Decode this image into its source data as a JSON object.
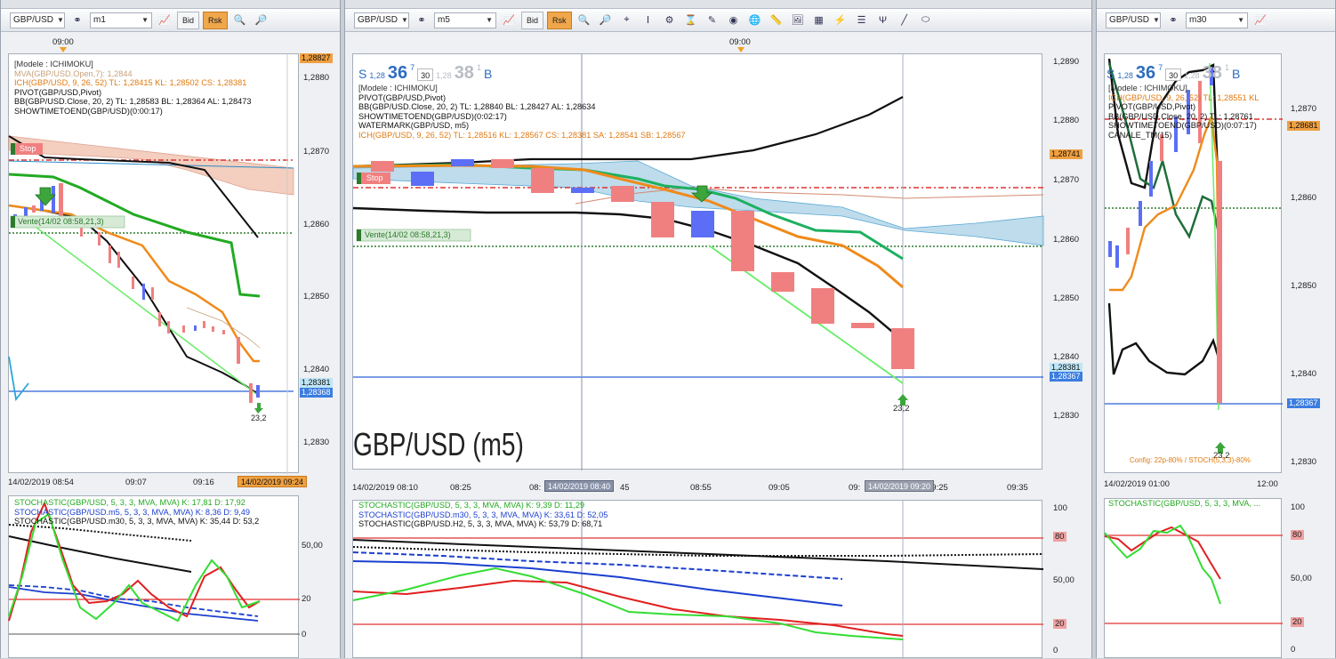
{
  "panels": {
    "left": {
      "toolbar": {
        "symbol": "GBP/USD",
        "timeframe": "m1",
        "bid_label": "Bid",
        "ask_label": "Rsk"
      },
      "top_time": "09:00",
      "legend": [
        {
          "text": "[Modele : ICHIMOKU]",
          "color": "#333333"
        },
        {
          "text": "MVA(GBP/USD.Open,7): 1,2844",
          "color": "#c8a27a"
        },
        {
          "text": "ICH(GBP/USD, 9, 26, 52)  TL: 1,28415  KL: 1,28502  CS: 1,28381",
          "color": "#e07a10"
        },
        {
          "text": "PIVOT(GBP/USD,Pivot)",
          "color": "#111111"
        },
        {
          "text": "BB(GBP/USD.Close, 20, 2)  TL: 1,28583  BL: 1,28364  AL: 1,28473",
          "color": "#111111"
        },
        {
          "text": "SHOWTIMETOEND(GBP/USD)(0:00:17)",
          "color": "#111111"
        }
      ],
      "price_ticks": [
        "1,2880",
        "1,2870",
        "1,2860",
        "1,2850",
        "1,2840",
        "1,2830"
      ],
      "price_tags": {
        "top": "1,28827",
        "cs": "1,28381",
        "last": "1,28368"
      },
      "stop_label": "Stop",
      "vente_label": "Vente(14/02 08:58,21,3)",
      "signal_value": "23,2",
      "time_ticks": [
        "14/02/2019 08:54",
        "09:07",
        "09:16"
      ],
      "time_tag": "14/02/2019 09:24",
      "osc_legend": [
        {
          "text": "STOCHASTIC(GBP/USD, 5, 3, 3, MVA, MVA)  K: 17,81  D: 17,92",
          "color": "#22aa22"
        },
        {
          "text": "STOCHASTIC(GBP/USD.m5, 5, 3, 3, MVA, MVA)  K: 8,36  D: 9,49",
          "color": "#1a3fcf"
        },
        {
          "text": "STOCHASTIC(GBP/USD.m30, 5, 3, 3, MVA, MVA)  K: 35,44  D: 53,2",
          "color": "#111111"
        }
      ],
      "osc_ticks": [
        "50,00",
        "20",
        "0"
      ]
    },
    "middle": {
      "toolbar": {
        "symbol": "GBP/USD",
        "timeframe": "m5",
        "bid_label": "Bid",
        "ask_label": "Rsk"
      },
      "top_time": "09:00",
      "sblock": {
        "s": "S",
        "s_small": "1,28",
        "s_big": "36",
        "s_sup": "7",
        "box": "30",
        "b_small": "1,28",
        "b_big": "38",
        "b_sup": "1",
        "b": "B"
      },
      "legend": [
        {
          "text": "[Modele : ICHIMOKU]",
          "color": "#333333"
        },
        {
          "text": "PIVOT(GBP/USD,Pivot)",
          "color": "#111111"
        },
        {
          "text": "BB(GBP/USD.Close, 20, 2)  TL: 1,28840  BL: 1,28427  AL: 1,28634",
          "color": "#111111"
        },
        {
          "text": "SHOWTIMETOEND(GBP/USD)(0:02:17)",
          "color": "#111111"
        },
        {
          "text": "WATERMARK(GBP/USD, m5)",
          "color": "#111111"
        },
        {
          "text": "ICH(GBP/USD, 9, 26, 52)  TL: 1,28516  KL: 1,28567  CS: 1,28381  SA: 1,28541  SB: 1,28567",
          "color": "#e07a10"
        }
      ],
      "price_ticks": [
        "1,2890",
        "1,2880",
        "1,2870",
        "1,2860",
        "1,2850",
        "1,2840",
        "1,2830"
      ],
      "price_tags": {
        "upper": "1,28741",
        "cs": "1,28381",
        "last": "1,28367"
      },
      "stop_label": "Stop",
      "vente_label": "Vente(14/02 08:58,21,3)",
      "signal_value": "23,2",
      "watermark": "GBP/USD (m5)",
      "time_ticks": [
        "14/02/2019 08:10",
        "08:25",
        "08:",
        "45",
        "08:55",
        "09:05",
        "09:",
        "09:25",
        "09:35"
      ],
      "time_tag_a": "14/02/2019 08:40",
      "time_tag_b": "14/02/2019 09:20",
      "osc_legend": [
        {
          "text": "STOCHASTIC(GBP/USD, 5, 3, 3, MVA, MVA)  K: 9,39  D: 11,29",
          "color": "#22aa22"
        },
        {
          "text": "STOCHASTIC(GBP/USD.m30, 5, 3, 3, MVA, MVA)  K: 33,61  D: 52,05",
          "color": "#1a3fcf"
        },
        {
          "text": "STOCHASTIC(GBP/USD.H2, 5, 3, 3, MVA, MVA)  K: 53,79  D: 68,71",
          "color": "#111111"
        }
      ],
      "osc_ticks": [
        "100",
        "80",
        "50,00",
        "20",
        "0"
      ]
    },
    "right": {
      "toolbar": {
        "symbol": "GBP/USD",
        "timeframe": "m30"
      },
      "sblock": {
        "s": "S",
        "s_small": "1,28",
        "s_big": "36",
        "s_sup": "7",
        "box": "30",
        "b_small": "1,28",
        "b_big": "38",
        "b_sup": "1",
        "b": "B"
      },
      "legend": [
        {
          "text": "[Modele : ICHIMOKU]",
          "color": "#333333"
        },
        {
          "text": "ICH(GBP/USD, 9, 26, 52)  TL: 1,28551  KL",
          "color": "#e07a10"
        },
        {
          "text": "PIVOT(GBP/USD,Pivot)",
          "color": "#111111"
        },
        {
          "text": "BB(GBP/USD.Close, 20, 2)  TL: 1,28761",
          "color": "#111111"
        },
        {
          "text": "SHOWTIMETOEND(GBP/USD)(0:07:17)",
          "color": "#111111"
        },
        {
          "text": "CANALE_TM(15)",
          "color": "#111111"
        }
      ],
      "price_ticks": [
        "1,2870",
        "1,2860",
        "1,2850",
        "1,2840",
        "1,2830"
      ],
      "price_tags": {
        "upper": "1,28681",
        "last": "1,28367"
      },
      "signal_value": "23,2",
      "config_text": "Config: 22p-80% / STOCH(5,3,3)-80%",
      "time_ticks": [
        "14/02/2019 01:00",
        "12:00"
      ],
      "osc_legend": [
        {
          "text": "STOCHASTIC(GBP/USD, 5, 3, 3, MVA, ...",
          "color": "#22aa22"
        }
      ],
      "osc_ticks": [
        "100",
        "80",
        "50,00",
        "20",
        "0"
      ]
    }
  },
  "colors": {
    "bear": "#f08080",
    "bull": "#5b6ef5",
    "green_line": "#22aa22",
    "orange_line": "#f08a1a",
    "black_line": "#111111",
    "cloud": "#b7d9ea",
    "cloud_red": "#f3c9b8",
    "red_dash": "#e03030",
    "green_dot": "#2d7a2d",
    "blue_line": "#2a62d8",
    "stoch_red": "#e02020"
  }
}
